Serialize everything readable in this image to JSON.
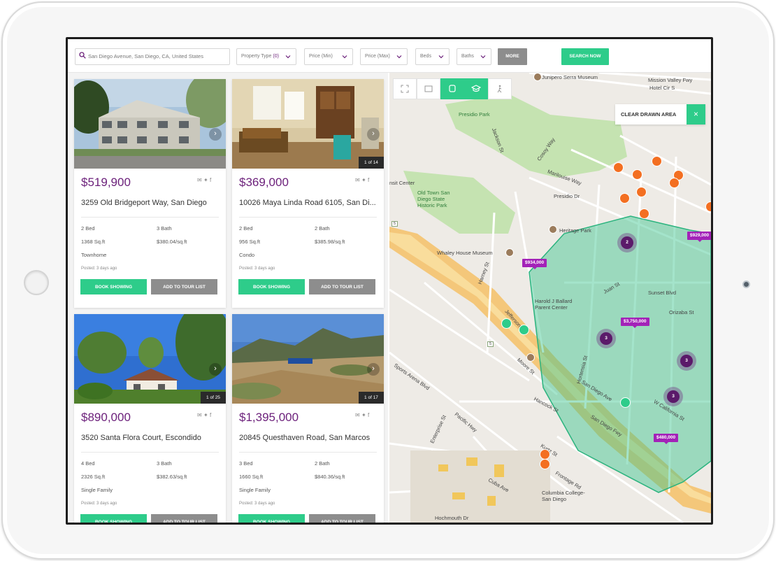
{
  "search": {
    "location_value": "San Diego Avenue, San Diego, CA, United States",
    "property_type_label": "Property Type",
    "property_type_count": "(0)",
    "price_min_placeholder": "Price (Min)",
    "price_max_placeholder": "Price (Max)",
    "beds_label": "Beds",
    "baths_label": "Baths",
    "more_label": "MORE",
    "search_now_label": "SEARCH NOW"
  },
  "listings": [
    {
      "price": "$519,900",
      "address": "3259 Old Bridgeport Way, San Diego",
      "beds": "2 Bed",
      "baths": "3 Bath",
      "sqft": "1368 Sq.ft",
      "price_per_sqft": "$380.04/sq.ft",
      "type": "Townhome",
      "posted": "Posted: 3 days ago",
      "pager": ""
    },
    {
      "price": "$369,000",
      "address": "10026 Maya Linda Road 6105, San Di...",
      "beds": "2 Bed",
      "baths": "2 Bath",
      "sqft": "956 Sq.ft",
      "price_per_sqft": "$385.98/sq.ft",
      "type": "Condo",
      "posted": "Posted: 3 days ago",
      "pager": "1 of 14"
    },
    {
      "price": "$890,000",
      "address": "3520 Santa Flora Court, Escondido",
      "beds": "4 Bed",
      "baths": "3 Bath",
      "sqft": "2326 Sq.ft",
      "price_per_sqft": "$382.63/sq.ft",
      "type": "Single Family",
      "posted": "Posted: 3 days ago",
      "pager": "1 of 25"
    },
    {
      "price": "$1,395,000",
      "address": "20845 Questhaven Road, San Marcos",
      "beds": "3 Bed",
      "baths": "2 Bath",
      "sqft": "1660 Sq.ft",
      "price_per_sqft": "$840.36/sq.ft",
      "type": "Single Family",
      "posted": "Posted: 3 days ago",
      "pager": "1 of 17"
    }
  ],
  "card_actions": {
    "book_label": "BOOK SHOWING",
    "tour_label": "ADD TO TOUR LIST"
  },
  "map": {
    "clear_drawn_area_label": "CLEAR DRAWN AREA",
    "clear_x": "×",
    "labels": {
      "junipero": "Junipero Serra Museum",
      "mission_valley": "Mission Valley Fwy",
      "hotel_cir": "Hotel Cir S",
      "presidio_park": "Presidio Park",
      "old_town": "Old Town San Diego State Historic Park",
      "heritage_park": "Heritage Park",
      "whaley": "Whaley House Museum",
      "ballard": "Harold J Ballard Parent Center",
      "transit": "nsit Center",
      "columbia": "Columbia College-San Diego",
      "sunset": "Sunset Blvd",
      "orizaba": "Orizaba St",
      "juan_st": "Juan St",
      "san_diego_ave": "San Diego Ave",
      "w_california": "W California St",
      "san_diego_fwy": "San Diego Fwy",
      "hancock": "Hancock St",
      "pacific_hwy": "Pacific Hwy",
      "sports_arena": "Sports Arena Blvd",
      "kurtz": "Kurtz St",
      "frontage": "Frontage Rd",
      "cuba": "Cuba Ave",
      "hochmouth": "Hochmouth Dr",
      "marilouise": "Marilouise Way",
      "presidio_dr": "Presidio Dr",
      "jackson": "Jackson St",
      "cosoy": "Cosoy Way",
      "moore": "Moore St",
      "jefferson": "Jefferson St",
      "harney": "Harney St",
      "taylor": "Taylor St",
      "enterprise": "Enterprise St",
      "hortensia": "Hortensia St"
    },
    "price_tags": [
      "$934,000",
      "$929,000",
      "$3,750,000",
      "$480,000"
    ],
    "clusters": [
      "2",
      "3",
      "3",
      "3"
    ],
    "route_labels": [
      "5",
      "5"
    ]
  },
  "colors": {
    "accent": "#2ecc8a",
    "brand_purple": "#6b1f7a",
    "pin_orange": "#f36f21",
    "tag_purple": "#a322b8"
  }
}
